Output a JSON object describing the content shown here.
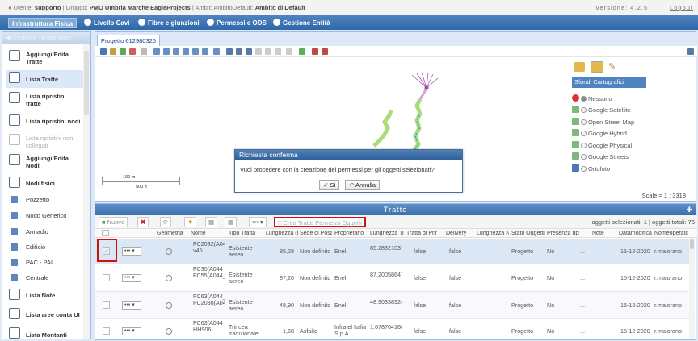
{
  "topbar": {
    "user_label": "Utente:",
    "user": "supporto",
    "group_label": "| Gruppo:",
    "group": "PMO Umbria Marche EagleProjects",
    "ambit": "| Ambit: AmbitoDefault:",
    "ambit_default": "Ambito di Default",
    "version": "Versione: 4.2.5",
    "logout": "Logout"
  },
  "menu": [
    {
      "label": "Infrastruttura Fisica"
    },
    {
      "label": "Livello Cavi"
    },
    {
      "label": "Fibre e giunzioni"
    },
    {
      "label": "Permessi e ODS"
    },
    {
      "label": "Gestione Entità"
    }
  ],
  "sidebar": {
    "header": "Gestione infrastrutture",
    "items": [
      {
        "label": "Aggiungi/Edita Tratte"
      },
      {
        "label": "Lista Tratte"
      },
      {
        "label": "Lista ripristini tratte"
      },
      {
        "label": "Lista ripristini nodi"
      },
      {
        "label": "Lista ripristini non collegati"
      },
      {
        "label": "Aggiungi/Edita Nodi"
      },
      {
        "label": "Nodi fisici"
      },
      {
        "label": "Pozzetto"
      },
      {
        "label": "Nodo Generico"
      },
      {
        "label": "Armadio"
      },
      {
        "label": "Edificio"
      },
      {
        "label": "PAC - PAL"
      },
      {
        "label": "Centrale"
      },
      {
        "label": "Lista Note"
      },
      {
        "label": "Lista aree conta UI"
      },
      {
        "label": "Lista Montanti"
      }
    ]
  },
  "map": {
    "tab": "Progetto 612980325",
    "scale_bar_top": "100 m",
    "scale_bar_bottom": "500 ft",
    "scale": "Scale = 1 : 3318",
    "layers_header": "Sfondi Cartografici",
    "layers": [
      "Nessuno",
      "Google Satellite",
      "Open Street Map",
      "Google Hybrid",
      "Google Physical",
      "Google Streets",
      "Ortofoto"
    ]
  },
  "dialog": {
    "title": "Richiesta conferma",
    "message": "Vuoi procedere con la creazione dei permessi per gli oggetti selezionati?",
    "yes": "Sì",
    "cancel": "Annulla"
  },
  "grid": {
    "title": "Tratte",
    "toolbar": {
      "new": "Nuovo",
      "menu": "•••",
      "crea": "Crea Tratte Permessi Oggetti"
    },
    "selection": "oggetti selezionati: 1 | oggetti totali: 75",
    "columns": [
      "Geometria",
      "Nome",
      "Tipo Tratta",
      "Lunghezza (r",
      "Sede di Posa",
      "Proprietario",
      "Lunghezza Ti",
      "Tratta di Prir",
      "Delivery",
      "Lunghezza N",
      "Stato Oggetti",
      "Presenza ripi",
      "Note",
      "Datamodifica",
      "Nomeoperatc"
    ],
    "rows": [
      {
        "nome": "FC2032(A044_849)-v45",
        "tipo": "Esistente aereo",
        "lung": "85,28",
        "sede": "Non definito",
        "prop": "Enel",
        "lungt": "85.2832103780674",
        "prim": "false",
        "deliv": "false",
        "stato": "Progetto",
        "pres": "No",
        "note": "...",
        "data": "15-12-2020",
        "oper": "r.maiorano"
      },
      {
        "nome": "FC30(A044_781)-FC55(A044_859)",
        "tipo": "Esistente aereo",
        "lung": "87,20",
        "sede": "Non definito",
        "prop": "Enel",
        "lungt": "87.2005864723331",
        "prim": "false",
        "deliv": "false",
        "stato": "Progetto",
        "pres": "No",
        "note": "...",
        "data": "15-12-2020",
        "oper": "r.maiorano"
      },
      {
        "nome": "FC63(A044_795)-FC2038(A044_735)",
        "tipo": "Esistente aereo",
        "lung": "48,90",
        "sede": "Non definito",
        "prop": "Enel",
        "lungt": "48.9033892430073",
        "prim": "false",
        "deliv": "false",
        "stato": "Progetto",
        "pres": "No",
        "note": "...",
        "data": "15-12-2020",
        "oper": "r.maiorano"
      },
      {
        "nome": "FC63(A044_795)-HH906",
        "tipo": "Trincea tradizionale",
        "lung": "1,68",
        "sede": "Asfalto",
        "prop": "Infratel Italia S.p.A.",
        "lungt": "1.67870416845562",
        "prim": "false",
        "deliv": "false",
        "stato": "Progetto",
        "pres": "No",
        "note": "...",
        "data": "15-12-2020",
        "oper": "r.maiorano"
      }
    ]
  }
}
